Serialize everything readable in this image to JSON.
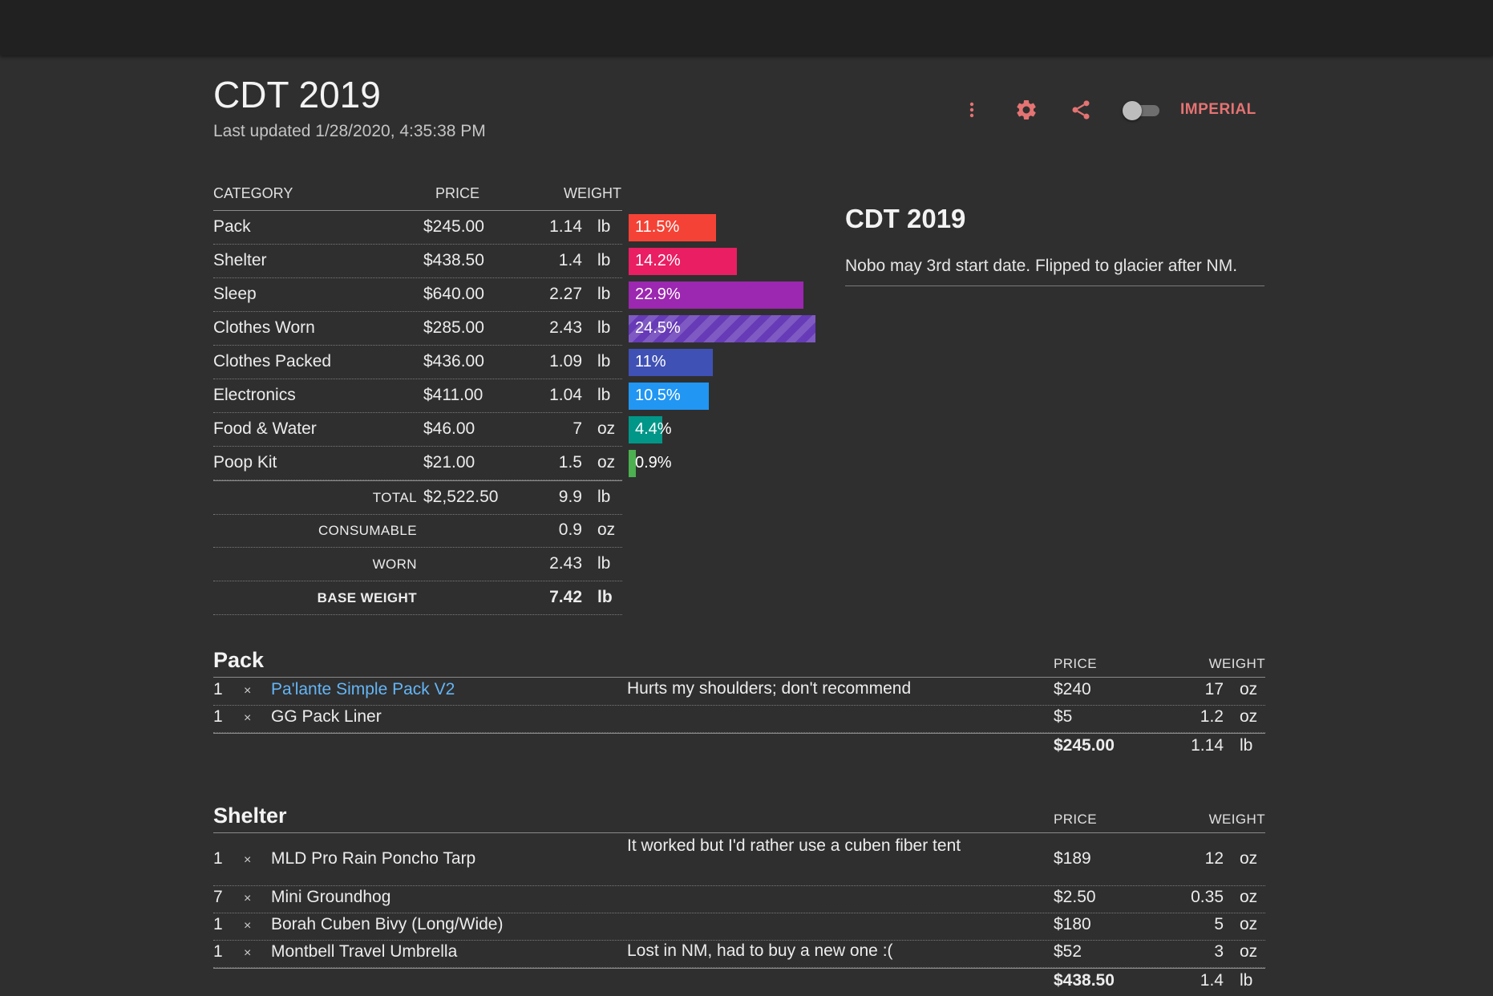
{
  "header": {
    "title": "CDT 2019",
    "updated": "Last updated 1/28/2020, 4:35:38 PM",
    "units_label": "IMPERIAL",
    "icons": [
      "more-vert-icon",
      "gear-icon",
      "share-icon"
    ],
    "accent_color": "#e57373"
  },
  "summary": {
    "columns": {
      "category": "CATEGORY",
      "price": "PRICE",
      "weight": "WEIGHT"
    },
    "rows": [
      {
        "category": "Pack",
        "price": "$245.00",
        "weight": "1.14",
        "unit": "lb",
        "percent_label": "11.5%",
        "percent": 11.5,
        "color": "#f44336"
      },
      {
        "category": "Shelter",
        "price": "$438.50",
        "weight": "1.4",
        "unit": "lb",
        "percent_label": "14.2%",
        "percent": 14.2,
        "color": "#e91e63"
      },
      {
        "category": "Sleep",
        "price": "$640.00",
        "weight": "2.27",
        "unit": "lb",
        "percent_label": "22.9%",
        "percent": 22.9,
        "color": "#9c27b0"
      },
      {
        "category": "Clothes Worn",
        "price": "$285.00",
        "weight": "2.43",
        "unit": "lb",
        "percent_label": "24.5%",
        "percent": 24.5,
        "color": "#673ab7",
        "striped": true
      },
      {
        "category": "Clothes Packed",
        "price": "$436.00",
        "weight": "1.09",
        "unit": "lb",
        "percent_label": "11%",
        "percent": 11,
        "color": "#3f51b5"
      },
      {
        "category": "Electronics",
        "price": "$411.00",
        "weight": "1.04",
        "unit": "lb",
        "percent_label": "10.5%",
        "percent": 10.5,
        "color": "#2196f3"
      },
      {
        "category": "Food & Water",
        "price": "$46.00",
        "weight": "7",
        "unit": "oz",
        "percent_label": "4.4%",
        "percent": 4.4,
        "color": "#009688"
      },
      {
        "category": "Poop Kit",
        "price": "$21.00",
        "weight": "1.5",
        "unit": "oz",
        "percent_label": "0.9%",
        "percent": 0.9,
        "color": "#4caf50"
      }
    ],
    "totals": [
      {
        "label": "TOTAL",
        "price": "$2,522.50",
        "weight": "9.9",
        "unit": "lb"
      },
      {
        "label": "CONSUMABLE",
        "price": "",
        "weight": "0.9",
        "unit": "oz"
      },
      {
        "label": "WORN",
        "price": "",
        "weight": "2.43",
        "unit": "lb"
      },
      {
        "label": "BASE WEIGHT",
        "price": "",
        "weight": "7.42",
        "unit": "lb",
        "bold": true
      }
    ]
  },
  "description": {
    "title": "CDT 2019",
    "text": "Nobo may 3rd start date. Flipped to glacier after NM."
  },
  "sections": [
    {
      "name": "Pack",
      "price_header": "PRICE",
      "weight_header": "WEIGHT",
      "items": [
        {
          "qty": "1",
          "x": "×",
          "name": "Pa'lante Simple Pack V2",
          "link": true,
          "note": "Hurts my shoulders; don't recommend",
          "price": "$240",
          "weight": "17",
          "unit": "oz"
        },
        {
          "qty": "1",
          "x": "×",
          "name": "GG Pack Liner",
          "link": false,
          "note": "",
          "price": "$5",
          "weight": "1.2",
          "unit": "oz"
        }
      ],
      "total": {
        "price": "$245.00",
        "weight": "1.14",
        "unit": "lb"
      }
    },
    {
      "name": "Shelter",
      "price_header": "PRICE",
      "weight_header": "WEIGHT",
      "items": [
        {
          "qty": "1",
          "x": "×",
          "name": "MLD Pro Rain Poncho Tarp",
          "link": false,
          "note": "It worked but I'd rather use a cuben fiber tent",
          "price": "$189",
          "weight": "12",
          "unit": "oz",
          "tall": true
        },
        {
          "qty": "7",
          "x": "×",
          "name": "Mini Groundhog",
          "link": false,
          "note": "",
          "price": "$2.50",
          "weight": "0.35",
          "unit": "oz"
        },
        {
          "qty": "1",
          "x": "×",
          "name": "Borah Cuben Bivy (Long/Wide)",
          "link": false,
          "note": "",
          "price": "$180",
          "weight": "5",
          "unit": "oz"
        },
        {
          "qty": "1",
          "x": "×",
          "name": "Montbell Travel Umbrella",
          "link": false,
          "note": "Lost in NM, had to buy a new one :(",
          "price": "$52",
          "weight": "3",
          "unit": "oz"
        }
      ],
      "total": {
        "price": "$438.50",
        "weight": "1.4",
        "unit": "lb"
      }
    }
  ]
}
